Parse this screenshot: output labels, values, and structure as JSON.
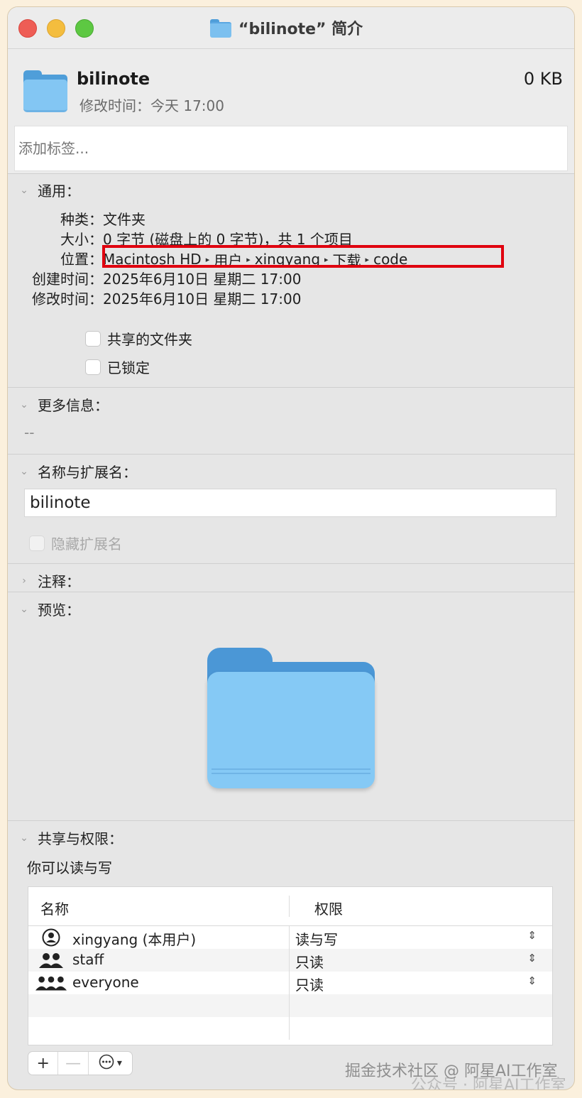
{
  "window": {
    "title": "“bilinote” 简介"
  },
  "header": {
    "name": "bilinote",
    "size": "0 KB",
    "modified": "修改时间：今天 17:00",
    "tags_placeholder": "添加标签..."
  },
  "general": {
    "heading": "通用：",
    "kind_label": "种类：",
    "kind_value": "文件夹",
    "size_label": "大小：",
    "size_value": "0 字节 (磁盘上的 0 字节)，共 1 个项目",
    "where_label": "位置：",
    "where_path": [
      "Macintosh HD",
      "用户",
      "xingyang",
      "下载",
      "code"
    ],
    "created_label": "创建时间：",
    "created_value": "2025年6月10日 星期二 17:00",
    "modified_label": "修改时间：",
    "modified_value": "2025年6月10日 星期二 17:00",
    "shared_folder": "共享的文件夹",
    "locked": "已锁定"
  },
  "more_info": {
    "heading": "更多信息：",
    "value": "--"
  },
  "name_ext": {
    "heading": "名称与扩展名：",
    "value": "bilinote",
    "hide_extension": "隐藏扩展名"
  },
  "comments": {
    "heading": "注释："
  },
  "preview": {
    "heading": "预览："
  },
  "sharing": {
    "heading": "共享与权限：",
    "note": "你可以读与写",
    "col_name": "名称",
    "col_priv": "权限",
    "rows": [
      {
        "name": "xingyang (本用户)",
        "priv": "读与写",
        "icon": "user-circle-icon"
      },
      {
        "name": "staff",
        "priv": "只读",
        "icon": "group-icon"
      },
      {
        "name": "everyone",
        "priv": "只读",
        "icon": "everyone-icon"
      }
    ]
  },
  "toolbar": {
    "add": "+",
    "remove": "—",
    "more": "⋯"
  },
  "watermark": {
    "line1": "掘金技术社区 @ 阿星AI工作室",
    "line2": "公众号 · 阿星AI工作室"
  },
  "colors": {
    "highlight": "#e0000e",
    "folder_blue": "#83c6f3"
  }
}
